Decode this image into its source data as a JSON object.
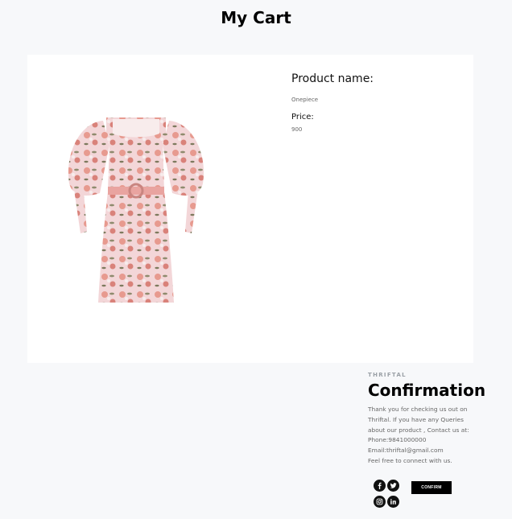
{
  "page": {
    "title": "My Cart"
  },
  "product": {
    "name_label": "Product name:",
    "name": "Onepiece",
    "price_label": "Price:",
    "price": "900",
    "image_icon": "floral-dress-image"
  },
  "confirmation": {
    "brand": "THRIFTAL",
    "title": "Confirmation",
    "lines": [
      "Thank you for checking us out on",
      "Thriftal. If you have any Queries",
      "about our product , Contact us at:",
      "Phone:9841000000",
      "Email:thriftal@gmail.com",
      "Feel free to connect with us."
    ],
    "button_label": "CONFIRM"
  },
  "socials": [
    {
      "icon": "facebook-icon"
    },
    {
      "icon": "twitter-icon"
    },
    {
      "icon": "instagram-icon"
    },
    {
      "icon": "linkedin-icon"
    }
  ],
  "colors": {
    "background": "#f7f8fa",
    "card": "#ffffff",
    "button": "#000000",
    "accent_text": "#9aa0a6"
  }
}
